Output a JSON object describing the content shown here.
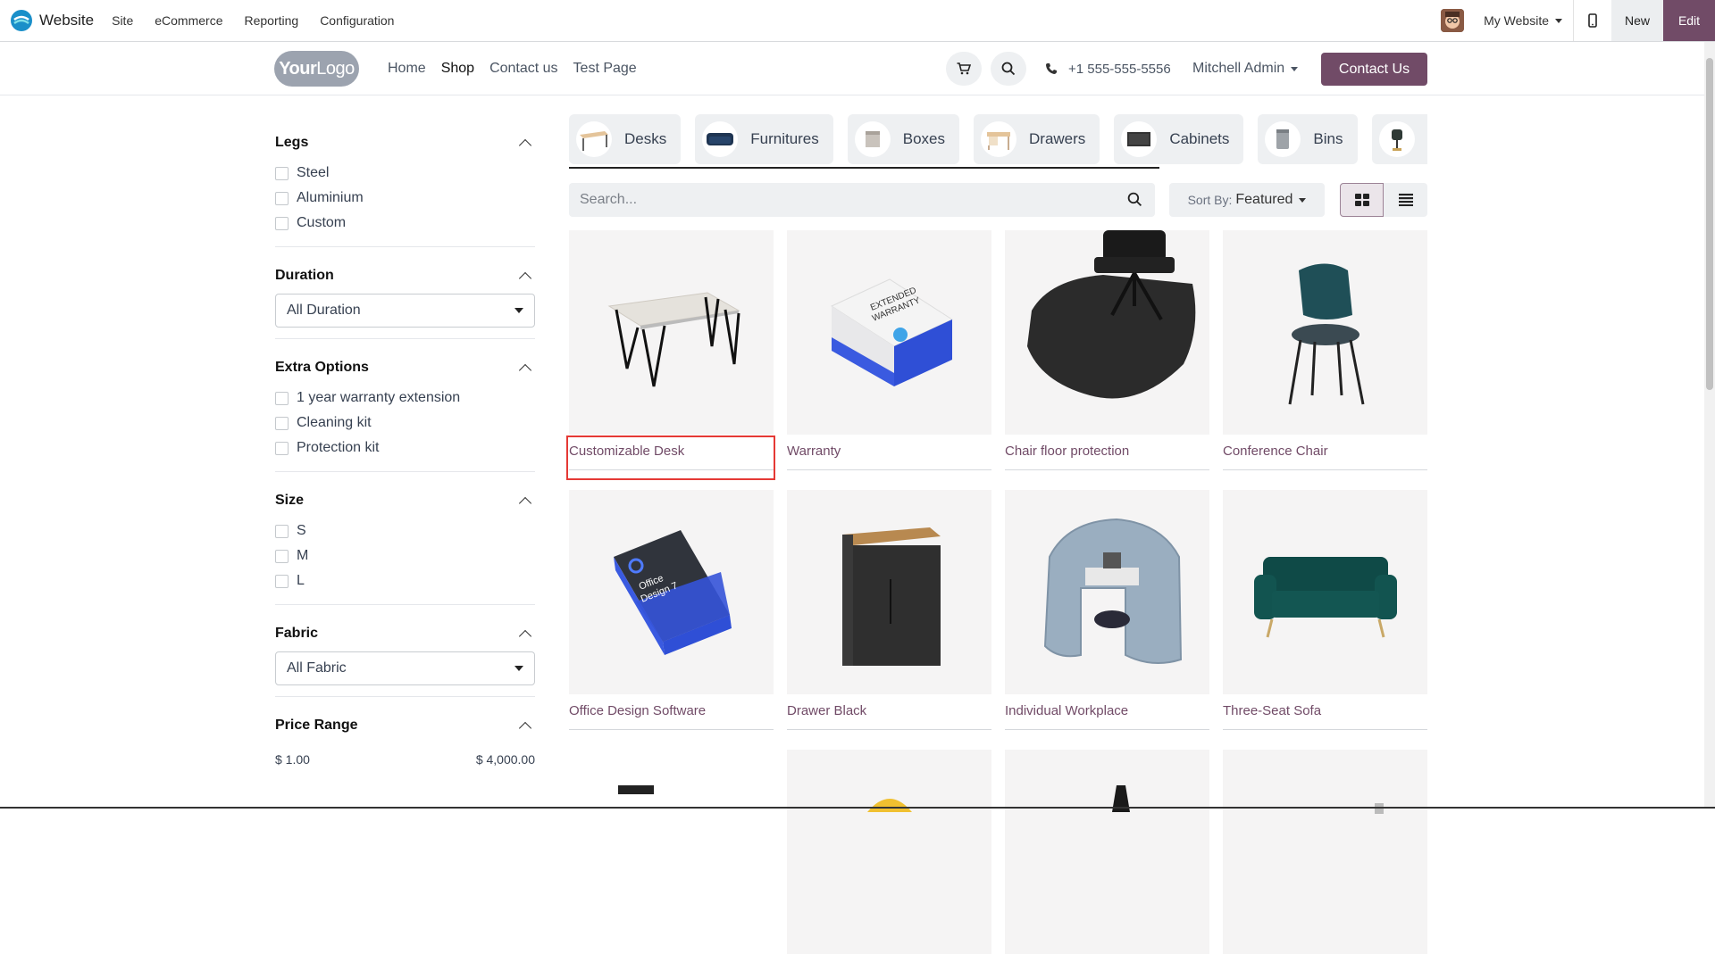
{
  "adminbar": {
    "brand": "Website",
    "menu": [
      "Site",
      "eCommerce",
      "Reporting",
      "Configuration"
    ],
    "website_switch": "My Website",
    "new_label": "New",
    "edit_label": "Edit"
  },
  "header": {
    "logo_text_a": "Your",
    "logo_text_b": "Logo",
    "nav": [
      "Home",
      "Shop",
      "Contact us",
      "Test Page"
    ],
    "active_nav": "Shop",
    "phone": "+1 555-555-5556",
    "user": "Mitchell Admin",
    "contact_button": "Contact Us"
  },
  "filters": {
    "legs": {
      "title": "Legs",
      "options": [
        "Steel",
        "Aluminium",
        "Custom"
      ]
    },
    "duration": {
      "title": "Duration",
      "selected": "All Duration"
    },
    "extra": {
      "title": "Extra Options",
      "options": [
        "1 year warranty extension",
        "Cleaning kit",
        "Protection kit"
      ]
    },
    "size": {
      "title": "Size",
      "options": [
        "S",
        "M",
        "L"
      ]
    },
    "fabric": {
      "title": "Fabric",
      "selected": "All Fabric"
    },
    "price": {
      "title": "Price Range",
      "min": "$ 1.00",
      "max": "$ 4,000.00"
    }
  },
  "categories": [
    "Desks",
    "Furnitures",
    "Boxes",
    "Drawers",
    "Cabinets",
    "Bins"
  ],
  "search": {
    "placeholder": "Search..."
  },
  "sort": {
    "label": "Sort By:",
    "value": "Featured"
  },
  "products": [
    "Customizable Desk",
    "Warranty",
    "Chair floor protection",
    "Conference Chair",
    "Office Design Software",
    "Drawer Black",
    "Individual Workplace",
    "Three-Seat Sofa"
  ],
  "colors": {
    "primary": "#714b67",
    "highlight": "#e53935"
  }
}
